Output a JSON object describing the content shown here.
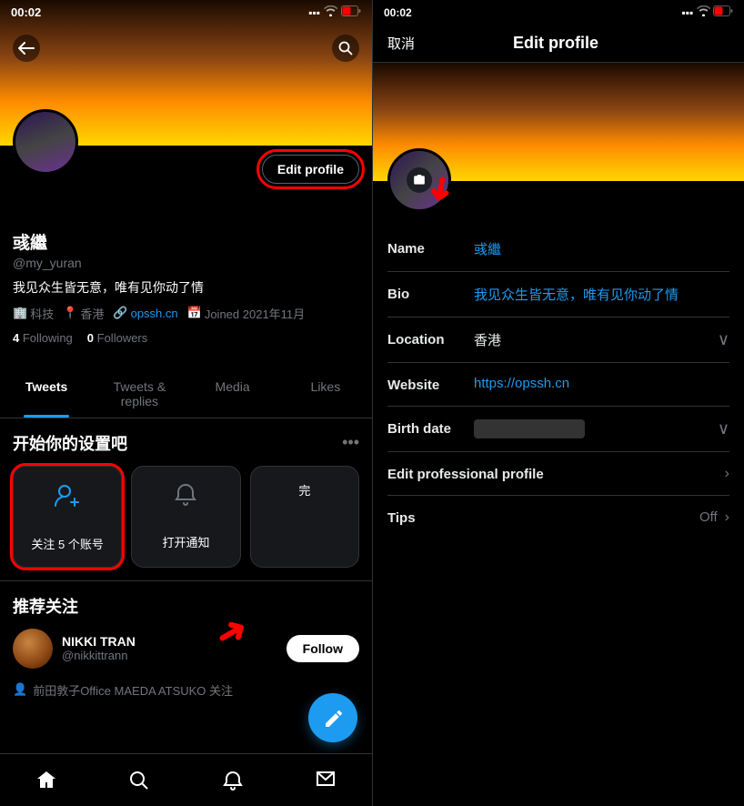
{
  "left": {
    "statusBar": {
      "time": "00:02",
      "locationIcon": "▶",
      "signalIcon": "▪▪▪",
      "wifiIcon": "wifi",
      "batteryIcon": "battery"
    },
    "profile": {
      "displayName": "彧繼",
      "handle": "@my_yuran",
      "bio": "我见众生皆无意，唯有见你动了情",
      "industry": "科技",
      "location": "香港",
      "website": "opssh.cn",
      "joined": "Joined 2021年11月",
      "following": "4",
      "followingLabel": "Following",
      "followers": "0",
      "followersLabel": "Followers"
    },
    "editProfileBtn": "Edit profile",
    "tabs": [
      {
        "label": "Tweets",
        "active": true
      },
      {
        "label": "Tweets & replies",
        "active": false
      },
      {
        "label": "Media",
        "active": false
      },
      {
        "label": "Likes",
        "active": false
      }
    ],
    "setup": {
      "title": "开始你的设置吧",
      "moreIcon": "•••",
      "card1Label": "关注 5 个账号",
      "card2Label": "打开通知",
      "card3Label": "完"
    },
    "recommend": {
      "title": "推荐关注",
      "user": {
        "name": "NIKKI TRAN",
        "handle": "@nikkittrann",
        "mutual": "前田敦子Office MAEDA ATSUKO 关注"
      },
      "followBtn": "Follow"
    },
    "bottomNav": {
      "homeIcon": "⌂",
      "searchIcon": "⌕",
      "notifIcon": "🔔",
      "mailIcon": "✉"
    },
    "fabIcon": "✦"
  },
  "right": {
    "statusBar": {
      "time": "00:02",
      "locationIcon": "▶"
    },
    "cancelBtn": "取消",
    "title": "Edit profile",
    "fields": {
      "name": {
        "label": "Name",
        "value": "彧繼"
      },
      "bio": {
        "label": "Bio",
        "value": "我见众生皆无意，唯有见你动了情"
      },
      "location": {
        "label": "Location",
        "value": "香港"
      },
      "website": {
        "label": "Website",
        "value": "https://opssh.cn"
      },
      "birthdate": {
        "label": "Birth date",
        "value": "●●●●●●●"
      },
      "professional": {
        "label": "Edit professional profile"
      },
      "tips": {
        "label": "Tips",
        "value": "Off"
      }
    }
  }
}
